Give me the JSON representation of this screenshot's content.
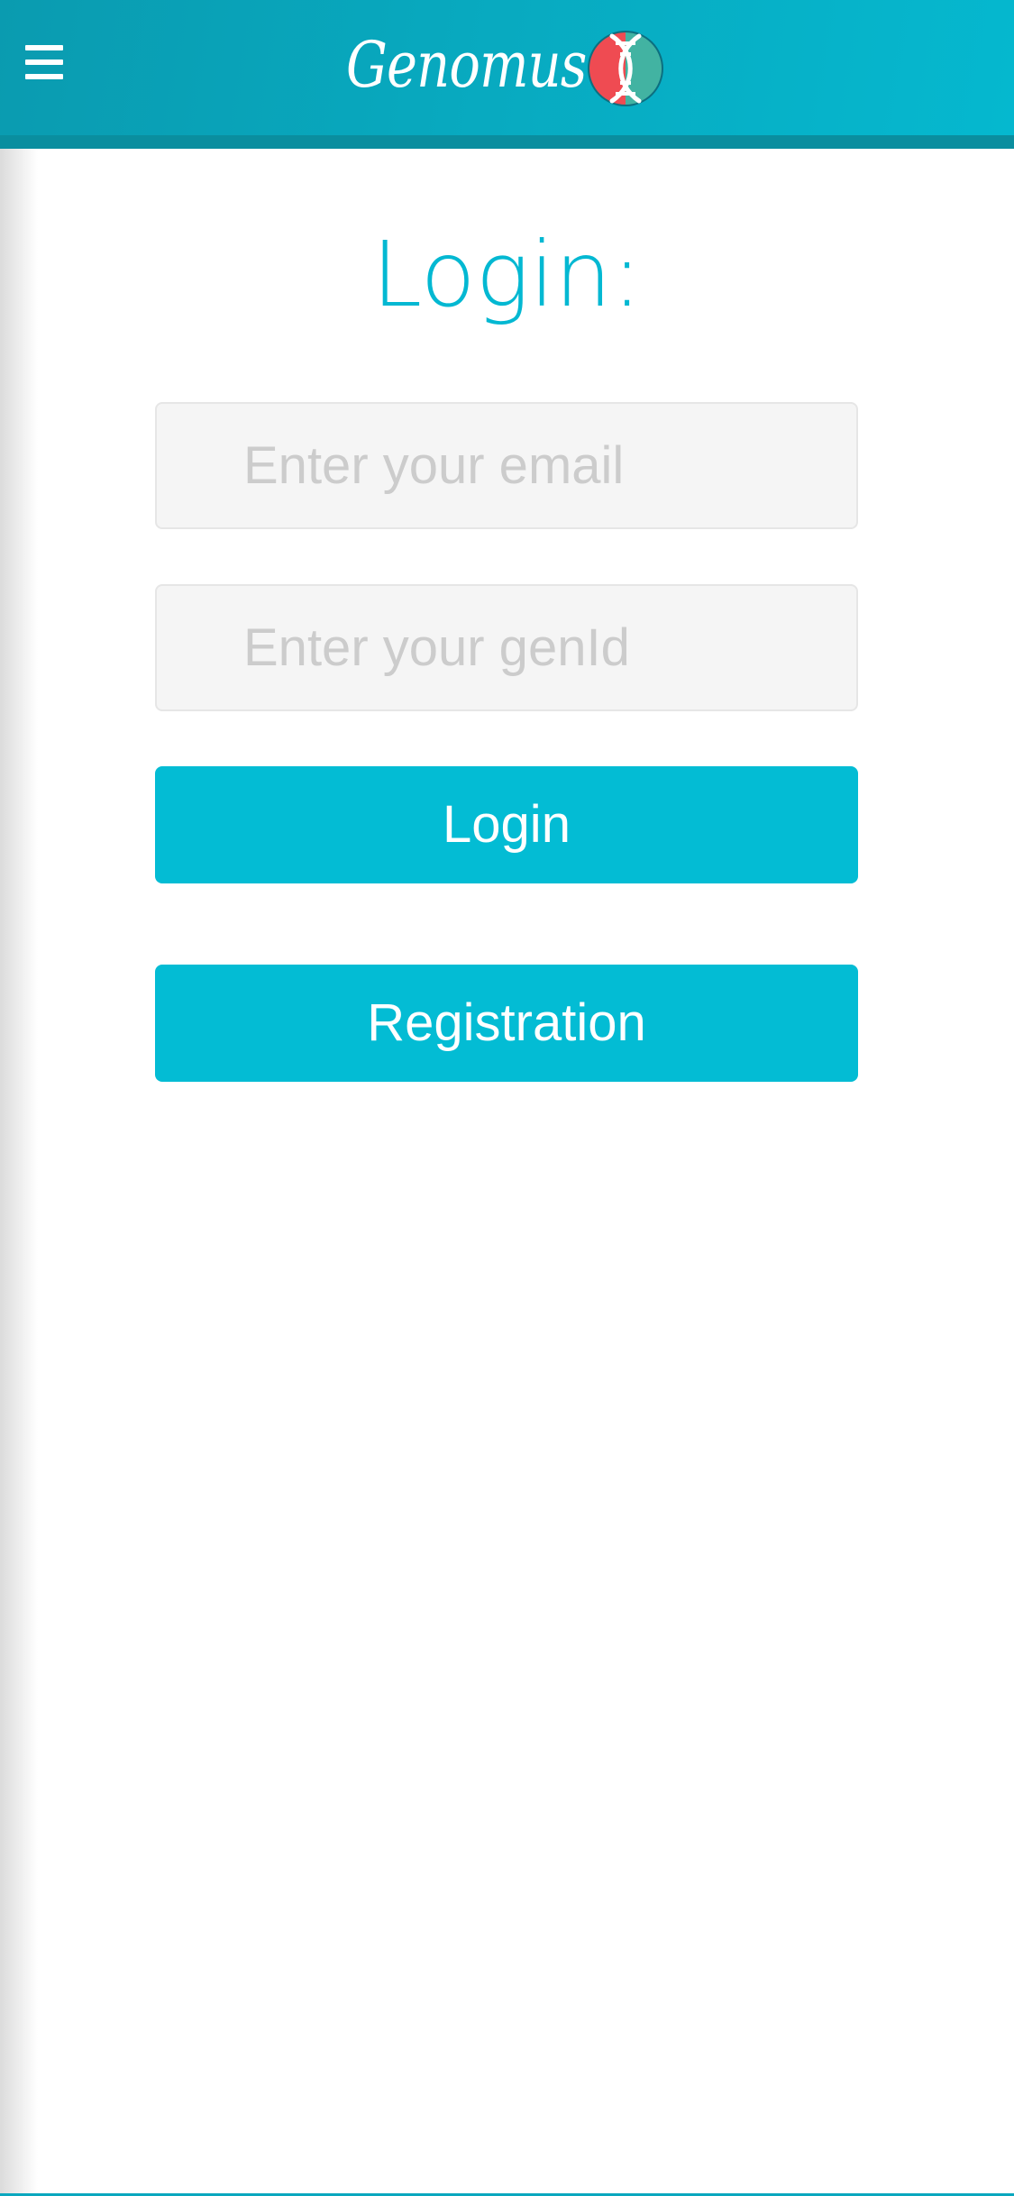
{
  "header": {
    "brand": "Genomus",
    "menu_icon": "hamburger-menu-icon",
    "logo_icon": "dna-icon",
    "colors": {
      "bar": "#08a9bf",
      "band": "#0a8e9f",
      "logo_red": "#ef4b52",
      "logo_teal": "#42b3a2"
    }
  },
  "main": {
    "title": "Login:",
    "email_placeholder": "Enter your email",
    "email_value": "",
    "genid_placeholder": "Enter your genId",
    "genid_value": "",
    "login_label": "Login",
    "registration_label": "Registration",
    "accent_color": "#03bcd4"
  }
}
